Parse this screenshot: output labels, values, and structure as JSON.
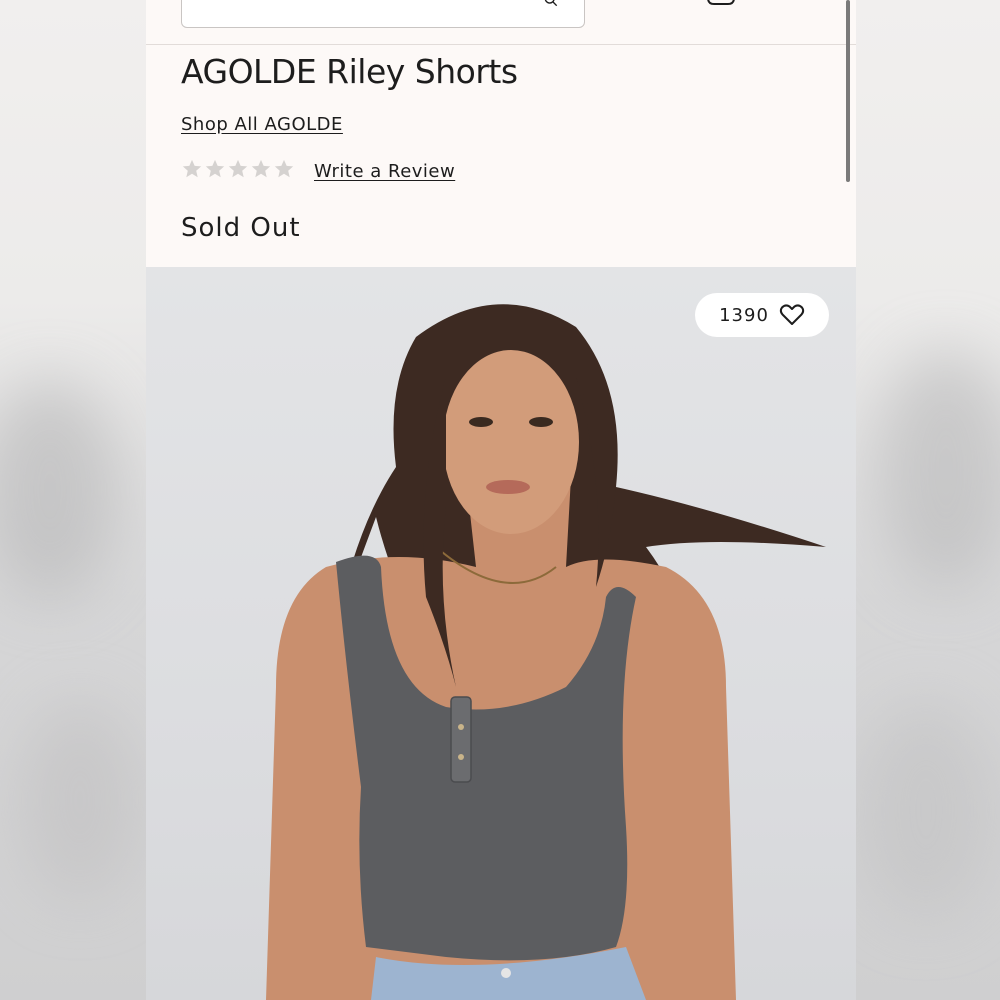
{
  "product": {
    "title": "AGOLDE Riley Shorts",
    "shop_all_link": "Shop All AGOLDE",
    "rating": {
      "stars_filled": 0,
      "stars_total": 5
    },
    "write_review_link": "Write a Review",
    "availability": "Sold Out"
  },
  "gallery": {
    "like_count": "1390"
  },
  "icons": {
    "search": "search-icon",
    "heart": "heart-icon",
    "star": "star-icon"
  },
  "colors": {
    "page_bg": "#fdf9f7",
    "text": "#1d1d1d",
    "star_empty": "#d5d2d0",
    "photo_bg": "#dcdde0"
  }
}
